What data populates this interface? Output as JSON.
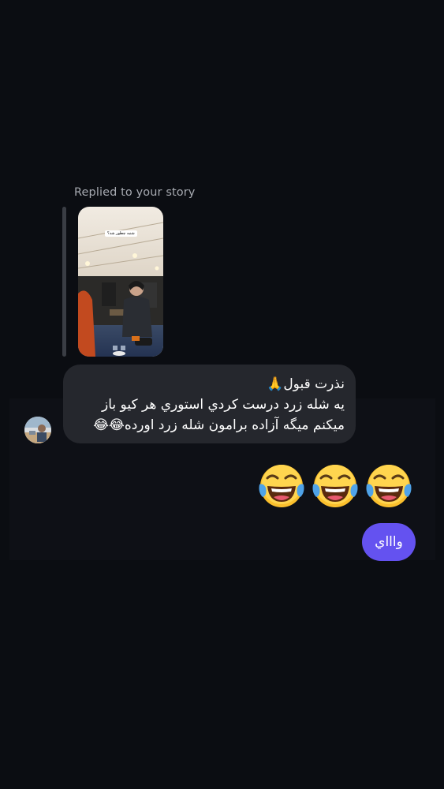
{
  "reply_context": {
    "label": "Replied to your story",
    "story_caption": "شنبه چطور شد؟"
  },
  "incoming_message": {
    "lines": [
      "نذرت قبول🙏",
      "یه شله زرد درست کردي استوري هر کیو باز",
      "میکنم میگه آزاده برامون شله زرد اورده😂😂"
    ]
  },
  "emoji_message": {
    "emojis": [
      "😂",
      "😂",
      "😂"
    ],
    "icon": "face-with-tears-of-joy"
  },
  "outgoing_message": {
    "text": "واااي"
  },
  "colors": {
    "background": "#0b0d12",
    "incoming_bubble": "#25272d",
    "outgoing_bubble": "#6452f0",
    "reply_label": "#a6a9b0"
  }
}
